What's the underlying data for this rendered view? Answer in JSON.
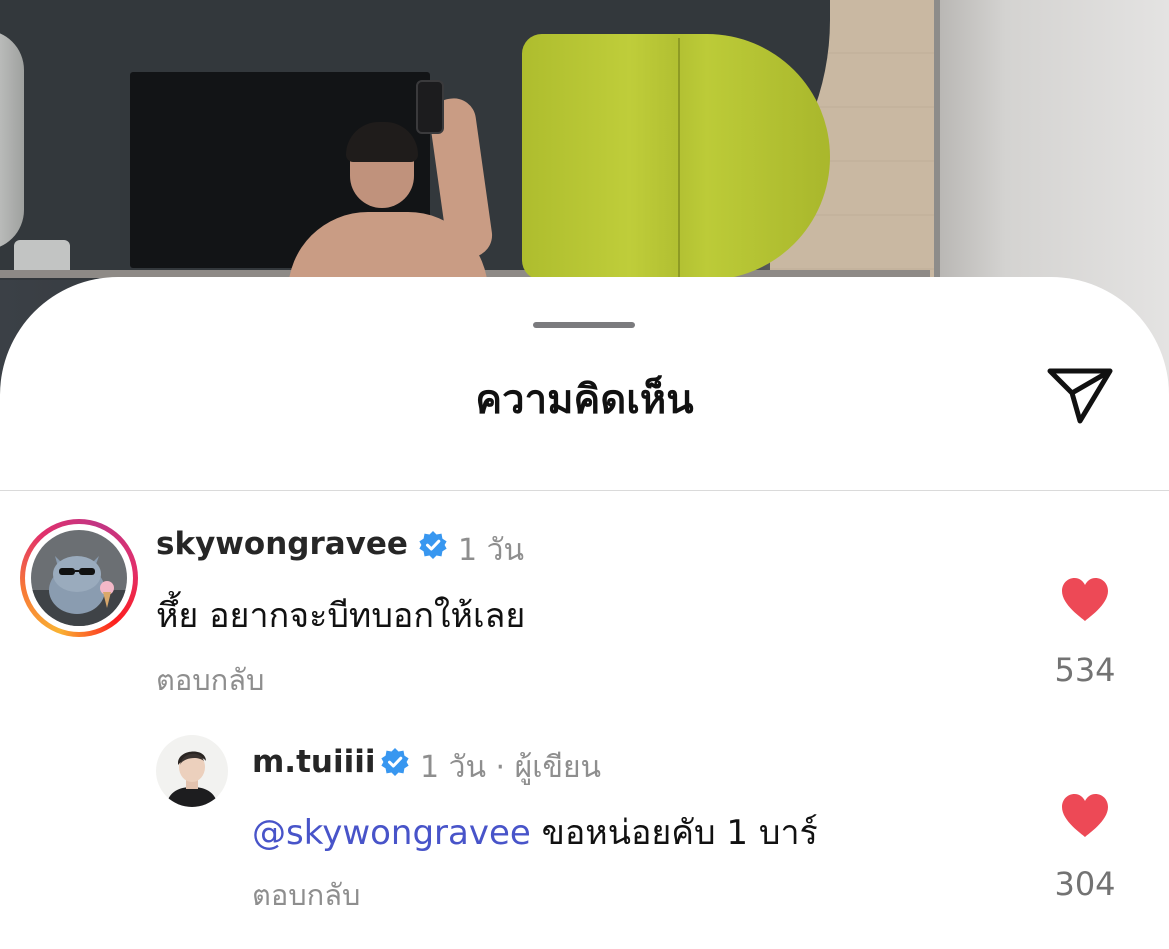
{
  "sheet": {
    "title": "ความคิดเห็น",
    "share_icon": "paper-plane-icon"
  },
  "comments": [
    {
      "username": "skywongravee",
      "verified": true,
      "time": "1 วัน",
      "text": "หึ้ย อยากจะบีทบอกให้เลย",
      "reply_label": "ตอบกลับ",
      "likes": "534",
      "liked": true,
      "story_ring": true
    },
    {
      "username": "m.tuiiii",
      "verified": true,
      "time": "1 วัน",
      "separator": "·",
      "author_label": "ผู้เขียน",
      "mention": "@skywongravee",
      "text": "ขอหน่อยคับ 1 บาร์",
      "reply_label": "ตอบกลับ",
      "likes": "304",
      "liked": true
    }
  ],
  "colors": {
    "heart": "#ed4956",
    "verified": "#3897f0",
    "mention": "#4854c9",
    "muted": "#8e8e8e"
  }
}
